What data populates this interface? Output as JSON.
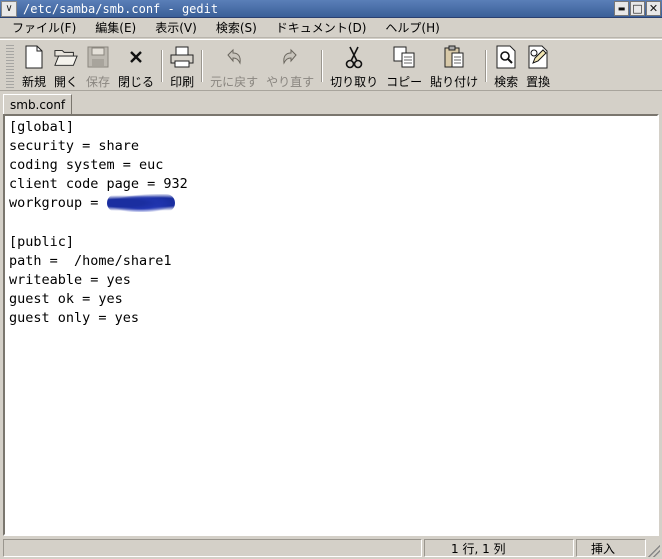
{
  "window": {
    "title": "/etc/samba/smb.conf - gedit",
    "menu_glyph": "∨",
    "minimize": "▬",
    "maximize": "□",
    "close": "✕"
  },
  "menubar": [
    {
      "name": "menu-file",
      "label": "ファイル(F)"
    },
    {
      "name": "menu-edit",
      "label": "編集(E)"
    },
    {
      "name": "menu-view",
      "label": "表示(V)"
    },
    {
      "name": "menu-search",
      "label": "検索(S)"
    },
    {
      "name": "menu-documents",
      "label": "ドキュメント(D)"
    },
    {
      "name": "menu-help",
      "label": "ヘルプ(H)"
    }
  ],
  "toolbar": {
    "new": "新規",
    "open": "開く",
    "save": "保存",
    "close": "閉じる",
    "print": "印刷",
    "undo": "元に戻す",
    "redo": "やり直す",
    "cut": "切り取り",
    "copy": "コピー",
    "paste": "貼り付け",
    "find": "検索",
    "replace": "置換"
  },
  "tab": {
    "label": "smb.conf"
  },
  "editor": {
    "lines": [
      "[global]",
      "security = share",
      "coding system = euc",
      "client code page = 932",
      "workgroup = ",
      "",
      "[public]",
      "path =  /home/share1",
      "writeable = yes",
      "guest ok = yes",
      "guest only = yes"
    ]
  },
  "statusbar": {
    "position": "1 行, 1 列",
    "mode": "挿入"
  }
}
